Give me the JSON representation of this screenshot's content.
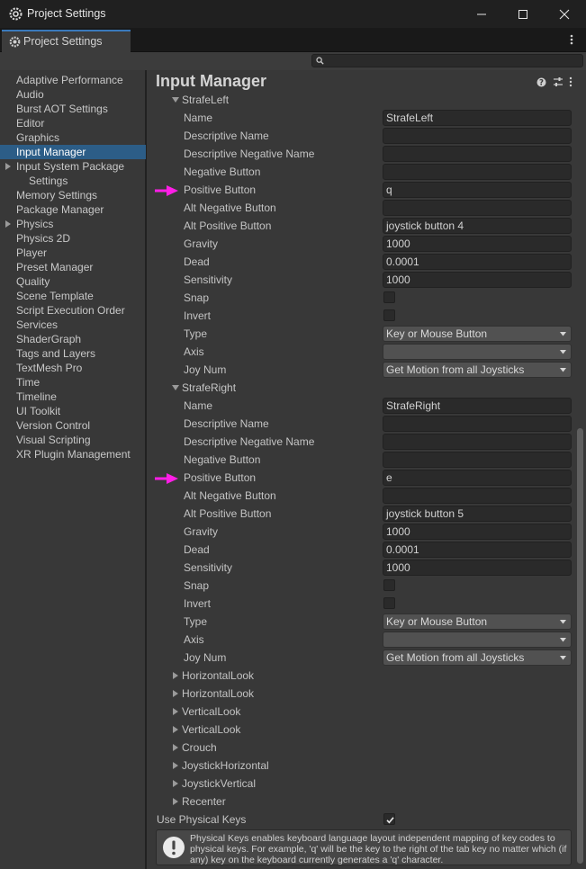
{
  "window": {
    "title": "Project Settings"
  },
  "tab": {
    "label": "Project Settings"
  },
  "sidebar": {
    "items": [
      {
        "label": "Adaptive Performance",
        "name": "sidebar-item-adaptive-performance"
      },
      {
        "label": "Audio",
        "name": "sidebar-item-audio"
      },
      {
        "label": "Burst AOT Settings",
        "name": "sidebar-item-burst-aot-settings"
      },
      {
        "label": "Editor",
        "name": "sidebar-item-editor"
      },
      {
        "label": "Graphics",
        "name": "sidebar-item-graphics"
      },
      {
        "label": "Input Manager",
        "name": "sidebar-item-input-manager",
        "selected": true
      },
      {
        "label": "Input System Package",
        "name": "sidebar-item-input-system-package",
        "expandable": true
      },
      {
        "label": "Settings",
        "name": "sidebar-item-input-system-settings",
        "sub": true
      },
      {
        "label": "Memory Settings",
        "name": "sidebar-item-memory-settings"
      },
      {
        "label": "Package Manager",
        "name": "sidebar-item-package-manager"
      },
      {
        "label": "Physics",
        "name": "sidebar-item-physics",
        "expandable": true
      },
      {
        "label": "Physics 2D",
        "name": "sidebar-item-physics-2d"
      },
      {
        "label": "Player",
        "name": "sidebar-item-player"
      },
      {
        "label": "Preset Manager",
        "name": "sidebar-item-preset-manager"
      },
      {
        "label": "Quality",
        "name": "sidebar-item-quality"
      },
      {
        "label": "Scene Template",
        "name": "sidebar-item-scene-template"
      },
      {
        "label": "Script Execution Order",
        "name": "sidebar-item-script-execution-order"
      },
      {
        "label": "Services",
        "name": "sidebar-item-services"
      },
      {
        "label": "ShaderGraph",
        "name": "sidebar-item-shadergraph"
      },
      {
        "label": "Tags and Layers",
        "name": "sidebar-item-tags-and-layers"
      },
      {
        "label": "TextMesh Pro",
        "name": "sidebar-item-textmesh-pro"
      },
      {
        "label": "Time",
        "name": "sidebar-item-time"
      },
      {
        "label": "Timeline",
        "name": "sidebar-item-timeline"
      },
      {
        "label": "UI Toolkit",
        "name": "sidebar-item-ui-toolkit"
      },
      {
        "label": "Version Control",
        "name": "sidebar-item-version-control"
      },
      {
        "label": "Visual Scripting",
        "name": "sidebar-item-visual-scripting"
      },
      {
        "label": "XR Plugin Management",
        "name": "sidebar-item-xr-plugin-management"
      }
    ]
  },
  "main": {
    "title": "Input Manager",
    "rows": [
      {
        "kind": "group",
        "label": "StrafeLeft",
        "expanded": true
      },
      {
        "kind": "text",
        "label": "Name",
        "value": "StrafeLeft"
      },
      {
        "kind": "text",
        "label": "Descriptive Name",
        "value": ""
      },
      {
        "kind": "text",
        "label": "Descriptive Negative Name",
        "value": ""
      },
      {
        "kind": "text",
        "label": "Negative Button",
        "value": ""
      },
      {
        "kind": "text",
        "label": "Positive Button",
        "value": "q",
        "highlight": true
      },
      {
        "kind": "text",
        "label": "Alt Negative Button",
        "value": ""
      },
      {
        "kind": "text",
        "label": "Alt Positive Button",
        "value": "joystick button 4"
      },
      {
        "kind": "text",
        "label": "Gravity",
        "value": "1000"
      },
      {
        "kind": "text",
        "label": "Dead",
        "value": "0.0001"
      },
      {
        "kind": "text",
        "label": "Sensitivity",
        "value": "1000"
      },
      {
        "kind": "check",
        "label": "Snap",
        "checked": false
      },
      {
        "kind": "check",
        "label": "Invert",
        "checked": false
      },
      {
        "kind": "dropdown",
        "label": "Type",
        "value": "Key or Mouse Button"
      },
      {
        "kind": "dropdown",
        "label": "Axis",
        "value": ""
      },
      {
        "kind": "dropdown",
        "label": "Joy Num",
        "value": "Get Motion from all Joysticks"
      },
      {
        "kind": "group",
        "label": "StrafeRight",
        "expanded": true
      },
      {
        "kind": "text",
        "label": "Name",
        "value": "StrafeRight"
      },
      {
        "kind": "text",
        "label": "Descriptive Name",
        "value": ""
      },
      {
        "kind": "text",
        "label": "Descriptive Negative Name",
        "value": ""
      },
      {
        "kind": "text",
        "label": "Negative Button",
        "value": ""
      },
      {
        "kind": "text",
        "label": "Positive Button",
        "value": "e",
        "highlight": true
      },
      {
        "kind": "text",
        "label": "Alt Negative Button",
        "value": ""
      },
      {
        "kind": "text",
        "label": "Alt Positive Button",
        "value": "joystick button 5"
      },
      {
        "kind": "text",
        "label": "Gravity",
        "value": "1000"
      },
      {
        "kind": "text",
        "label": "Dead",
        "value": "0.0001"
      },
      {
        "kind": "text",
        "label": "Sensitivity",
        "value": "1000"
      },
      {
        "kind": "check",
        "label": "Snap",
        "checked": false
      },
      {
        "kind": "check",
        "label": "Invert",
        "checked": false
      },
      {
        "kind": "dropdown",
        "label": "Type",
        "value": "Key or Mouse Button"
      },
      {
        "kind": "dropdown",
        "label": "Axis",
        "value": ""
      },
      {
        "kind": "dropdown",
        "label": "Joy Num",
        "value": "Get Motion from all Joysticks"
      },
      {
        "kind": "group",
        "label": "HorizontalLook",
        "expanded": false
      },
      {
        "kind": "group",
        "label": "HorizontalLook",
        "expanded": false
      },
      {
        "kind": "group",
        "label": "VerticalLook",
        "expanded": false
      },
      {
        "kind": "group",
        "label": "VerticalLook",
        "expanded": false
      },
      {
        "kind": "group",
        "label": "Crouch",
        "expanded": false
      },
      {
        "kind": "group",
        "label": "JoystickHorizontal",
        "expanded": false
      },
      {
        "kind": "group",
        "label": "JoystickVertical",
        "expanded": false
      },
      {
        "kind": "group",
        "label": "Recenter",
        "expanded": false
      }
    ],
    "use_physical_keys": {
      "label": "Use Physical Keys",
      "checked": true
    },
    "help": "Physical Keys enables keyboard language layout independent mapping of key codes to physical keys. For example, 'q' will be the key to the right of the tab key no matter which (if any) key on the keyboard currently generates a 'q' character."
  },
  "colors": {
    "highlight_arrow": "#ff1ee6",
    "selection": "#2c5d87",
    "tab_accent": "#3a79bb"
  },
  "icons": [
    "unity-settings-icon",
    "minimize-icon",
    "maximize-icon",
    "close-icon",
    "gear-icon",
    "kebab-menu-icon",
    "search-icon",
    "help-icon",
    "preset-icon",
    "warning-icon",
    "checkmark-icon",
    "caret-down-icon",
    "expand-triangle-icon",
    "pink-arrow-icon"
  ]
}
